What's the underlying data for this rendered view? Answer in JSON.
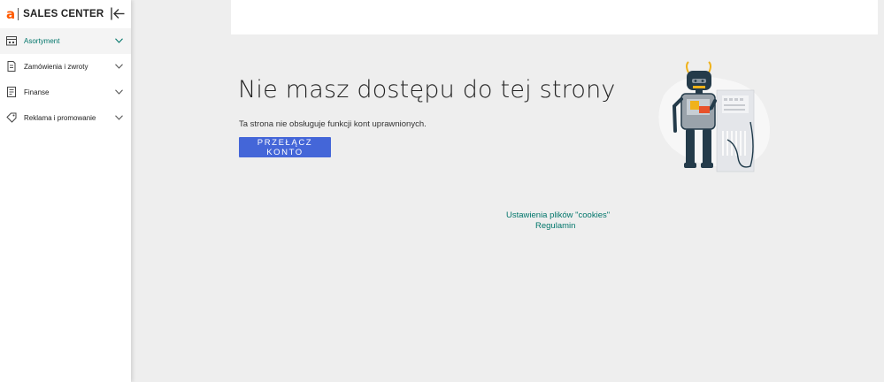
{
  "sidebar": {
    "brand_letter": "a",
    "brand_name": "SALES CENTER",
    "items": [
      {
        "label": "Asortyment",
        "icon": "storefront-icon",
        "active": true
      },
      {
        "label": "Zamówienia i zwroty",
        "icon": "document-icon",
        "active": false
      },
      {
        "label": "Finanse",
        "icon": "ledger-icon",
        "active": false
      },
      {
        "label": "Reklama i promowanie",
        "icon": "tag-icon",
        "active": false
      }
    ]
  },
  "main": {
    "title": "Nie masz dostępu do tej strony",
    "description": "Ta strona nie obsługuje funkcji kont uprawnionych.",
    "switch_button": "PRZEŁĄCZ KONTO"
  },
  "footer": {
    "cookies_link": "Ustawienia plików \"cookies\"",
    "terms_link": "Regulamin"
  },
  "colors": {
    "accent_teal": "#00756a",
    "button_blue": "#4466d8",
    "brand_orange": "#ff5a00"
  }
}
